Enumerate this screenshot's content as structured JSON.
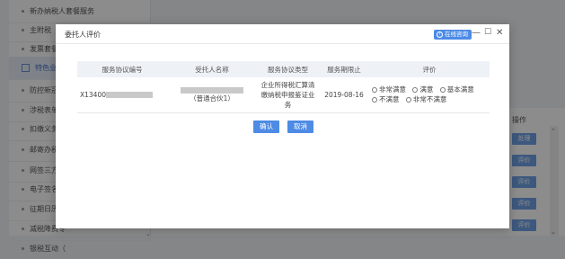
{
  "sidebar": {
    "items": [
      {
        "label": "新办纳税人套餐服务"
      },
      {
        "label": "主附税（费"
      },
      {
        "label": "发票套餐"
      },
      {
        "label": "特色业"
      },
      {
        "label": "防控新冠病"
      },
      {
        "label": "涉税表单填"
      },
      {
        "label": "扣缴义务人"
      },
      {
        "label": "邮寄办税"
      },
      {
        "label": "网签三方协"
      },
      {
        "label": "电子签名协"
      },
      {
        "label": "征期日历"
      },
      {
        "label": "减税降费专"
      },
      {
        "label": "银税互动（"
      }
    ]
  },
  "content": {
    "op_header": "操作",
    "buttons": [
      "处理",
      "评价",
      "评价",
      "评价",
      "评价"
    ]
  },
  "modal": {
    "title": "委托人评价",
    "online_consult": "在线咨询",
    "minimize": "—",
    "maximize": "☐",
    "close": "✕",
    "table": {
      "headers": [
        "服务协议编号",
        "受托人名称",
        "服务协议类型",
        "服务期限止",
        "评价"
      ],
      "row": {
        "agreement_id": "X13400",
        "trustee_suffix": "（普通合伙1）",
        "agreement_type": "企业所得税汇算清缴纳税申报鉴证业务",
        "deadline": "2019-08-16",
        "options": [
          "非常满意",
          "满意",
          "基本满意",
          "不满意",
          "非常不满意"
        ]
      }
    },
    "confirm_label": "确认",
    "cancel_label": "取消"
  }
}
